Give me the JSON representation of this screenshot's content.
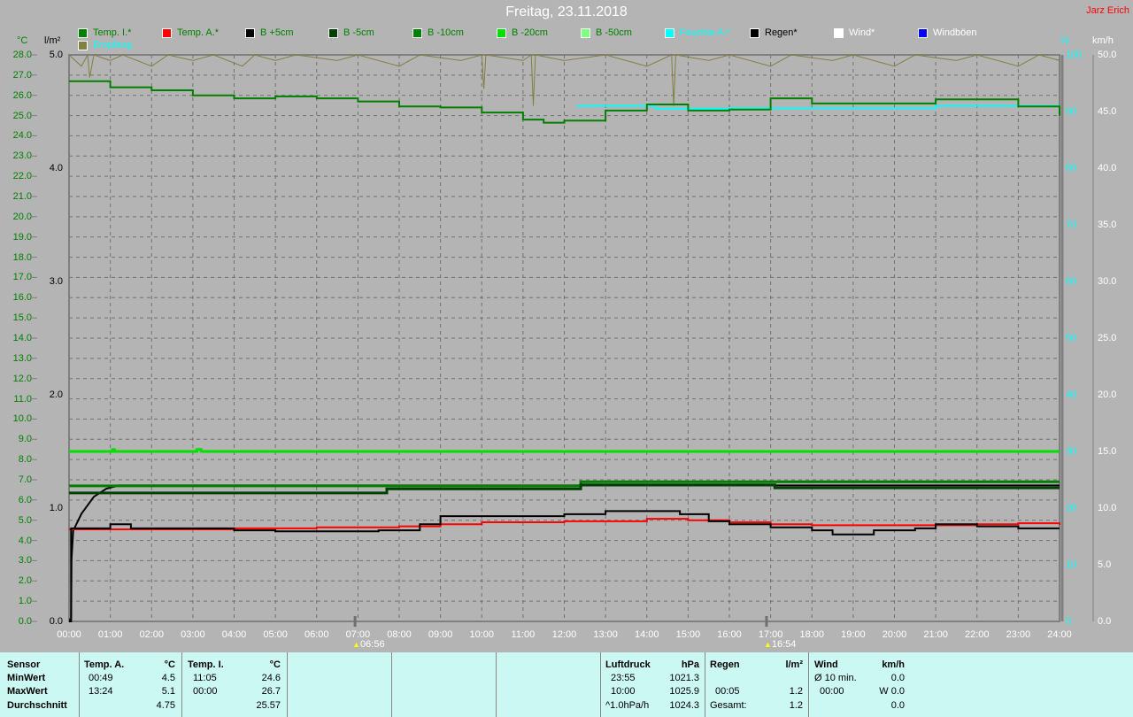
{
  "title": "Freitag, 23.11.2018",
  "author": "Jarz Erich",
  "legend": [
    {
      "label": "Temp. I.*",
      "color": "#008000",
      "text_color": "#008000"
    },
    {
      "label": "Temp. A.*",
      "color": "#ff0000",
      "text_color": "#008000"
    },
    {
      "label": "B +5cm",
      "color": "#000000",
      "text_color": "#008000"
    },
    {
      "label": "B -5cm",
      "color": "#004000",
      "text_color": "#008000"
    },
    {
      "label": "B -10cm",
      "color": "#008000",
      "text_color": "#008000"
    },
    {
      "label": "B -20cm",
      "color": "#00e000",
      "text_color": "#008000"
    },
    {
      "label": "B -50cm",
      "color": "#80ff80",
      "text_color": "#008000"
    },
    {
      "label": "Feuchte A.*",
      "color": "#00ffff",
      "text_color": "#00ffff"
    },
    {
      "label": "Regen*",
      "color": "#000000",
      "text_color": "#000000"
    },
    {
      "label": "Wind*",
      "color": "#ffffff",
      "text_color": "#ffffff"
    },
    {
      "label": "Windböen",
      "color": "#0000ff",
      "text_color": "#ffffff"
    },
    {
      "label": "Empfang",
      "color": "#808040",
      "text_color": "#00ffff"
    }
  ],
  "chart_data": {
    "type": "line",
    "title": "Freitag, 23.11.2018",
    "x_ticks": [
      "00:00",
      "01:00",
      "02:00",
      "03:00",
      "04:00",
      "05:00",
      "06:00",
      "07:00",
      "08:00",
      "09:00",
      "10:00",
      "11:00",
      "12:00",
      "13:00",
      "14:00",
      "15:00",
      "16:00",
      "17:00",
      "18:00",
      "19:00",
      "20:00",
      "21:00",
      "22:00",
      "23:00",
      "24:00"
    ],
    "xlim": [
      0,
      24
    ],
    "axes": {
      "temp": {
        "unit": "°C",
        "ylim": [
          0,
          28
        ],
        "ticks": [
          "28.0",
          "27.0",
          "26.0",
          "25.0",
          "24.0",
          "23.0",
          "22.0",
          "21.0",
          "20.0",
          "19.0",
          "18.0",
          "17.0",
          "16.0",
          "15.0",
          "14.0",
          "13.0",
          "12.0",
          "11.0",
          "10.0",
          "9.0",
          "8.0",
          "7.0",
          "6.0",
          "5.0",
          "4.0",
          "3.0",
          "2.0",
          "1.0",
          "0.0"
        ]
      },
      "rain": {
        "unit": "l/m²",
        "ylim": [
          0,
          5
        ],
        "ticks": [
          "5.0",
          "4.0",
          "3.0",
          "2.0",
          "1.0",
          "0.0"
        ]
      },
      "humidity": {
        "unit": "%",
        "ylim": [
          0,
          100
        ],
        "ticks": [
          "100",
          "90",
          "80",
          "70",
          "60",
          "50",
          "40",
          "30",
          "20",
          "10",
          "0"
        ]
      },
      "wind": {
        "unit": "km/h",
        "ylim": [
          0,
          50
        ],
        "ticks": [
          "50.0",
          "45.0",
          "40.0",
          "35.0",
          "30.0",
          "25.0",
          "20.0",
          "15.0",
          "10.0",
          "5.0",
          "0.0"
        ]
      }
    },
    "sunrise": "06:56",
    "sunset": "16:54",
    "sunrise_hour": 6.93,
    "sunset_hour": 16.9,
    "grid": true,
    "series": [
      {
        "name": "Empfang",
        "axis": "humidity",
        "color": "#808040",
        "width": 1,
        "points": [
          [
            0,
            100
          ],
          [
            0.3,
            98
          ],
          [
            0.45,
            100
          ],
          [
            0.5,
            96
          ],
          [
            0.6,
            100
          ],
          [
            1,
            99
          ],
          [
            1.3,
            100
          ],
          [
            2,
            98
          ],
          [
            2.4,
            100
          ],
          [
            3,
            99
          ],
          [
            3.5,
            100
          ],
          [
            4.2,
            98
          ],
          [
            4.5,
            100
          ],
          [
            5,
            99
          ],
          [
            5.5,
            100
          ],
          [
            6.5,
            99
          ],
          [
            7,
            100
          ],
          [
            8,
            98
          ],
          [
            8.5,
            100
          ],
          [
            9.5,
            99
          ],
          [
            10,
            100
          ],
          [
            10.05,
            94
          ],
          [
            10.1,
            100
          ],
          [
            11,
            99
          ],
          [
            11.2,
            100
          ],
          [
            11.25,
            91
          ],
          [
            11.3,
            100
          ],
          [
            12,
            99
          ],
          [
            13,
            100
          ],
          [
            14,
            98
          ],
          [
            14.6,
            100
          ],
          [
            14.65,
            91
          ],
          [
            14.7,
            100
          ],
          [
            15.5,
            99
          ],
          [
            16,
            100
          ],
          [
            17,
            98
          ],
          [
            17.5,
            100
          ],
          [
            18.5,
            99
          ],
          [
            19,
            100
          ],
          [
            20,
            98
          ],
          [
            20.5,
            100
          ],
          [
            21.5,
            99
          ],
          [
            22,
            100
          ],
          [
            23,
            98
          ],
          [
            23.5,
            100
          ],
          [
            24,
            99
          ]
        ]
      },
      {
        "name": "Feuchte A.*",
        "axis": "humidity",
        "color": "#00ffff",
        "width": 2,
        "points": [
          [
            12.3,
            91
          ],
          [
            12.5,
            91
          ],
          [
            14.2,
            90.5
          ],
          [
            16,
            90.6
          ],
          [
            21,
            91
          ],
          [
            24,
            91
          ]
        ]
      },
      {
        "name": "Regen*",
        "axis": "rain",
        "color": "#000000",
        "width": 2,
        "points": [
          [
            0,
            0
          ],
          [
            0.05,
            0
          ],
          [
            0.06,
            0.55
          ],
          [
            0.1,
            0.8
          ],
          [
            0.3,
            0.95
          ],
          [
            0.6,
            1.1
          ],
          [
            0.9,
            1.17
          ],
          [
            1.2,
            1.2
          ],
          [
            7.5,
            1.2
          ],
          [
            24,
            1.2
          ]
        ]
      },
      {
        "name": "B -20cm",
        "axis": "temp",
        "color": "#00e000",
        "width": 3,
        "points": [
          [
            0,
            8.4
          ],
          [
            1,
            8.4
          ],
          [
            1.05,
            8.5
          ],
          [
            1.1,
            8.4
          ],
          [
            3,
            8.4
          ],
          [
            3.1,
            8.5
          ],
          [
            3.2,
            8.4
          ],
          [
            24,
            8.4
          ]
        ]
      },
      {
        "name": "B -10cm",
        "axis": "temp",
        "color": "#008000",
        "width": 3,
        "points": [
          [
            0,
            6.7
          ],
          [
            12.3,
            6.7
          ],
          [
            12.4,
            6.9
          ],
          [
            24,
            6.9
          ]
        ]
      },
      {
        "name": "B -5cm",
        "axis": "temp",
        "color": "#004000",
        "width": 3,
        "points": [
          [
            0,
            6.35
          ],
          [
            7.6,
            6.35
          ],
          [
            7.7,
            6.55
          ],
          [
            12.3,
            6.55
          ],
          [
            12.4,
            6.75
          ],
          [
            17,
            6.75
          ],
          [
            17.1,
            6.6
          ],
          [
            24,
            6.6
          ]
        ]
      },
      {
        "name": "Temp. A.*",
        "axis": "temp",
        "color": "#ff0000",
        "width": 2,
        "points": [
          [
            0,
            4.55
          ],
          [
            2,
            4.55
          ],
          [
            4,
            4.6
          ],
          [
            6,
            4.65
          ],
          [
            8,
            4.7
          ],
          [
            9,
            4.8
          ],
          [
            10,
            4.9
          ],
          [
            12,
            4.95
          ],
          [
            13,
            4.95
          ],
          [
            14,
            5.07
          ],
          [
            15,
            5.0
          ],
          [
            16,
            4.9
          ],
          [
            17,
            4.8
          ],
          [
            18,
            4.75
          ],
          [
            20,
            4.75
          ],
          [
            22,
            4.8
          ],
          [
            23,
            4.85
          ],
          [
            24,
            4.77
          ]
        ]
      },
      {
        "name": "B +5cm",
        "axis": "temp",
        "color": "#000000",
        "width": 2,
        "points": [
          [
            0,
            0.1
          ],
          [
            0.05,
            4.6
          ],
          [
            0.5,
            4.6
          ],
          [
            1,
            4.8
          ],
          [
            1.5,
            4.6
          ],
          [
            4,
            4.5
          ],
          [
            5,
            4.45
          ],
          [
            6,
            4.45
          ],
          [
            7.5,
            4.5
          ],
          [
            8.5,
            4.8
          ],
          [
            9,
            5.2
          ],
          [
            10,
            5.2
          ],
          [
            12,
            5.3
          ],
          [
            13,
            5.45
          ],
          [
            14,
            5.45
          ],
          [
            14.8,
            5.3
          ],
          [
            15.5,
            4.95
          ],
          [
            16,
            4.8
          ],
          [
            17,
            4.65
          ],
          [
            18,
            4.5
          ],
          [
            18.5,
            4.3
          ],
          [
            19.5,
            4.5
          ],
          [
            20.5,
            4.6
          ],
          [
            21,
            4.8
          ],
          [
            22,
            4.7
          ],
          [
            23,
            4.6
          ],
          [
            24,
            4.6
          ]
        ]
      },
      {
        "name": "Temp. I.*",
        "axis": "temp",
        "color": "#008000",
        "width": 2,
        "points": [
          [
            0,
            26.7
          ],
          [
            1,
            26.4
          ],
          [
            2,
            26.25
          ],
          [
            3,
            26.0
          ],
          [
            4,
            25.85
          ],
          [
            5,
            25.95
          ],
          [
            6,
            25.85
          ],
          [
            7,
            25.7
          ],
          [
            8,
            25.45
          ],
          [
            9,
            25.4
          ],
          [
            10,
            25.15
          ],
          [
            11,
            24.8
          ],
          [
            11.5,
            24.65
          ],
          [
            12,
            24.75
          ],
          [
            13,
            25.25
          ],
          [
            14,
            25.55
          ],
          [
            15,
            25.25
          ],
          [
            16,
            25.3
          ],
          [
            17,
            25.85
          ],
          [
            18,
            25.6
          ],
          [
            20,
            25.6
          ],
          [
            21,
            25.8
          ],
          [
            22,
            25.8
          ],
          [
            23,
            25.45
          ],
          [
            24,
            25.0
          ]
        ]
      }
    ]
  },
  "stats": {
    "sensor": {
      "header": "Sensor",
      "rows": [
        "MinWert",
        "MaxWert",
        "Durchschnitt"
      ]
    },
    "temp_a": {
      "header": "Temp. A.",
      "unit": "°C",
      "min_time": "00:49",
      "min": "4.5",
      "max_time": "13:24",
      "max": "5.1",
      "avg": "4.75"
    },
    "temp_i": {
      "header": "Temp. I.",
      "unit": "°C",
      "min_time": "11:05",
      "min": "24.6",
      "max_time": "00:00",
      "max": "26.7",
      "avg": "25.57"
    },
    "pressure": {
      "header": "Luftdruck",
      "unit": "hPa",
      "min_time": "23:55",
      "min": "1021.3",
      "max_time": "10:00",
      "max": "1025.9",
      "trend": "^1.0hPa/h",
      "current": "1024.3"
    },
    "rain": {
      "header": "Regen",
      "unit": "l/m²",
      "max_time": "00:05",
      "max": "1.2",
      "total_label": "Gesamt:",
      "total": "1.2"
    },
    "wind": {
      "header": "Wind",
      "unit": "km/h",
      "avg_label": "Ø 10 min.",
      "avg": "0.0",
      "max_time": "00:00",
      "max": "W 0.0",
      "current": "0.0"
    }
  }
}
